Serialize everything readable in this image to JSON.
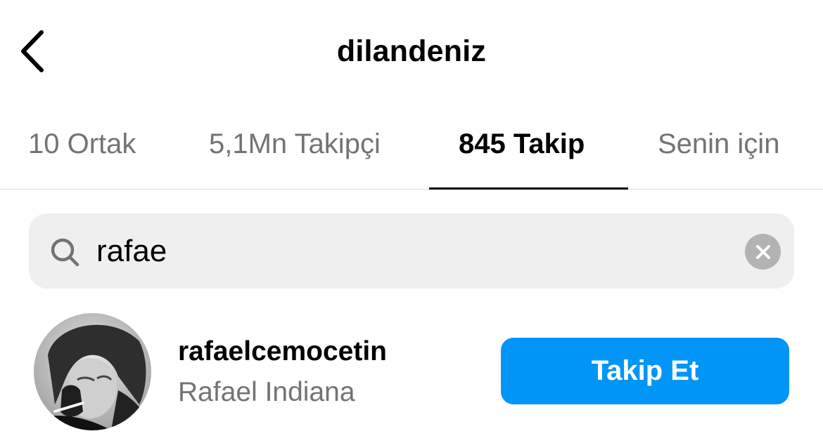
{
  "header": {
    "title": "dilandeniz",
    "back_icon": "chevron-left-icon"
  },
  "tabs": [
    {
      "label": "10 Ortak",
      "active": false
    },
    {
      "label": "5,1Mn Takipçi",
      "active": false
    },
    {
      "label": "845 Takip",
      "active": true
    },
    {
      "label": "Senin için",
      "active": false
    }
  ],
  "search": {
    "value": "rafae",
    "search_icon": "search-icon",
    "clear_icon": "clear-icon"
  },
  "results": [
    {
      "username": "rafaelcemocetin",
      "full_name": "Rafael Indiana",
      "follow_label": "Takip Et"
    }
  ],
  "colors": {
    "accent": "#0095f6",
    "secondary_text": "#737373",
    "search_background": "#efefef",
    "divider": "#dbdbdb"
  }
}
